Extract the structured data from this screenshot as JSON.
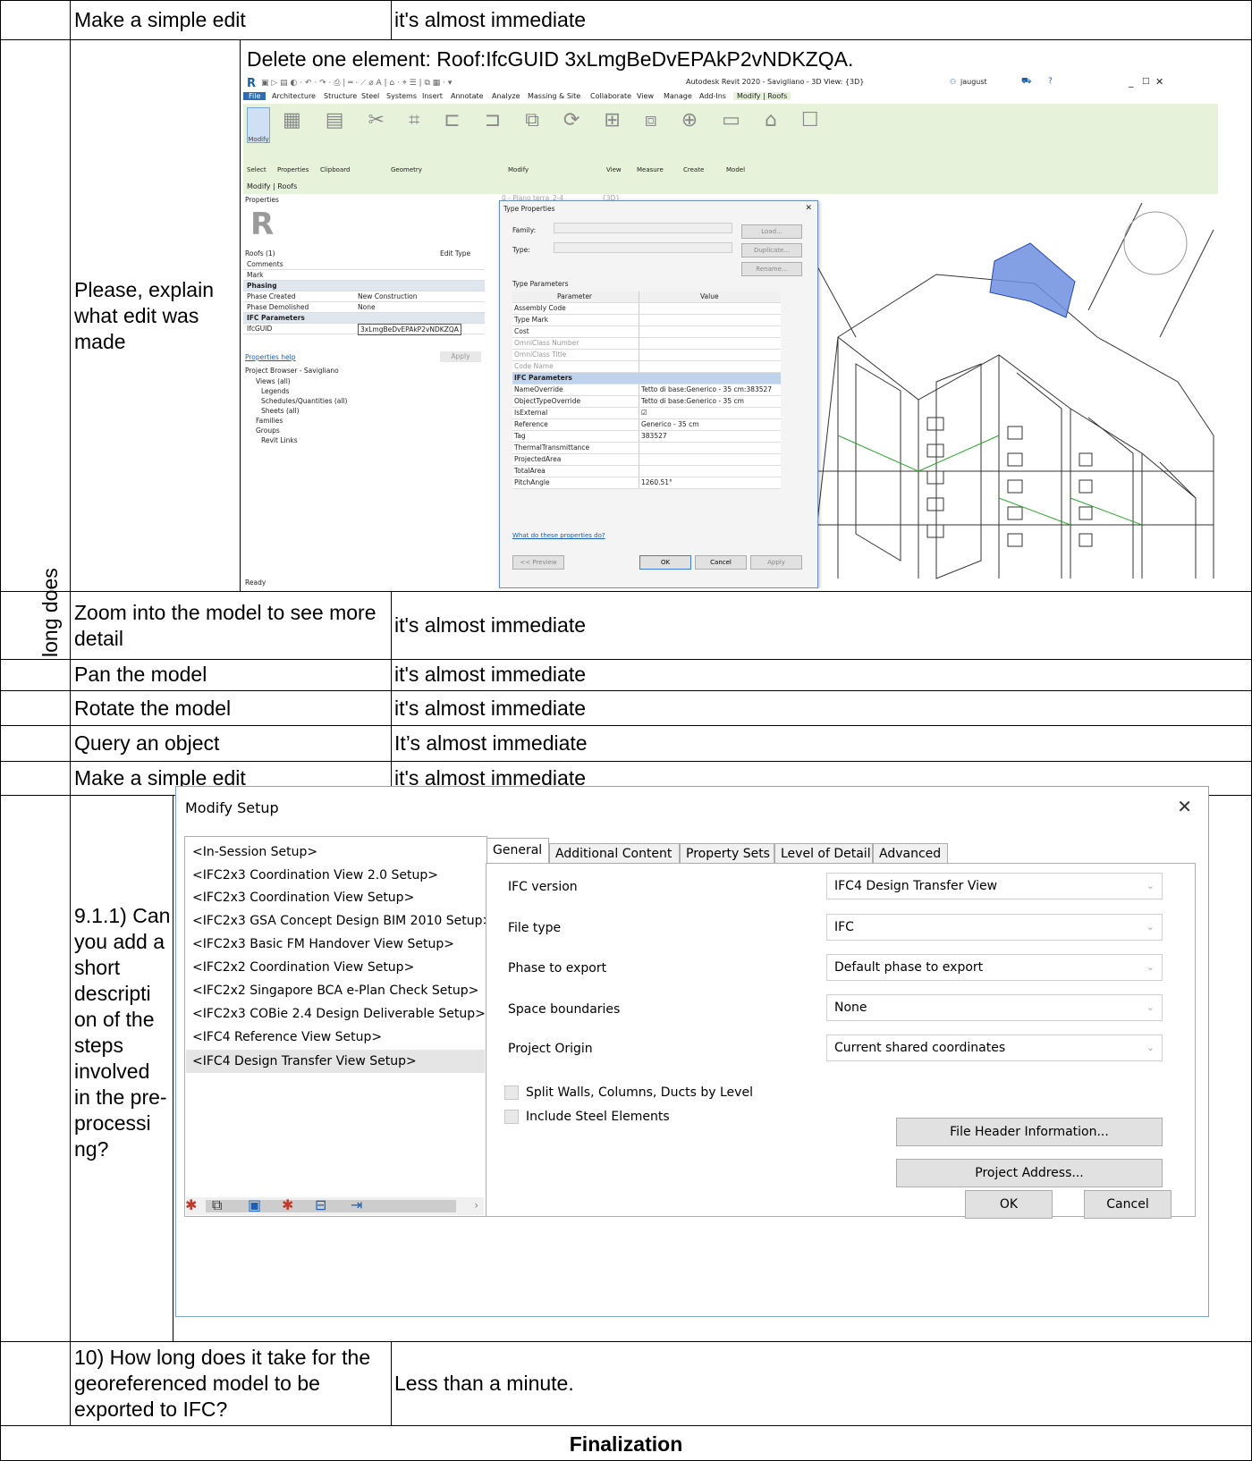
{
  "table": {
    "rows": [
      {
        "q": "Make a simple edit",
        "a": "it's almost immediate"
      },
      {
        "heading": "Delete one element: Roof:IfcGUID 3xLmgBeDvEPAkP2vNDKZQA.",
        "q": "Please, explain what edit was made"
      },
      {
        "side": "long does",
        "q": "Zoom into the model to see more detail",
        "a": "it's almost immediate"
      },
      {
        "q": "Pan the model",
        "a": "it's almost immediate"
      },
      {
        "q": "Rotate the model",
        "a": "it's almost immediate"
      },
      {
        "q": "Query an object",
        "a": "It’s almost immediate"
      },
      {
        "q": "Make a simple edit",
        "a": "it's almost immediate"
      },
      {
        "q": "9.1.1) Can you add a short descripti on of the steps involved in the pre- processi ng?"
      },
      {
        "q": "10) How long does it take for the georeferenced model to be exported to IFC?",
        "a": "Less than a minute."
      }
    ],
    "footer": "Finalization"
  },
  "revit": {
    "title": "Autodesk Revit 2020 - Savigliano - 3D View: {3D}",
    "user": "jaugust",
    "tabs": [
      "File",
      "Architecture",
      "Structure",
      "Steel",
      "Systems",
      "Insert",
      "Annotate",
      "Analyze",
      "Massing & Site",
      "Collaborate",
      "View",
      "Manage",
      "Add-Ins",
      "Modify | Roofs"
    ],
    "ribbon_groups": [
      "Select",
      "Properties",
      "Clipboard",
      "Geometry",
      "Modify",
      "View",
      "Measure",
      "Create",
      "Model"
    ],
    "context": "Modify | Roofs",
    "properties_header": "Properties",
    "type_selector": "Roofs (1)",
    "edit_type": "Edit Type",
    "props": [
      {
        "k": "Comments",
        "v": ""
      },
      {
        "k": "Mark",
        "v": ""
      },
      {
        "k": "Phasing",
        "v": "",
        "section": true
      },
      {
        "k": "Phase Created",
        "v": "New Construction"
      },
      {
        "k": "Phase Demolished",
        "v": "None"
      },
      {
        "k": "IFC Parameters",
        "v": "",
        "section": true
      },
      {
        "k": "IfcGUID",
        "v": "3xLmgBeDvEPAkP2vNDKZQA"
      }
    ],
    "properties_help": "Properties help",
    "apply": "Apply",
    "browser_title": "Project Browser - Savigliano",
    "browser_items": [
      "Views (all)",
      "Legends",
      "Schedules/Quantities (all)",
      "Sheets (all)",
      "Families",
      "Groups",
      "Revit Links"
    ],
    "status": "Ready",
    "view_tabs": [
      "0 - Piano terra_2-4",
      "{3D}"
    ],
    "type_properties": {
      "title": "Type Properties",
      "family_label": "Family:",
      "type_label": "Type:",
      "load": "Load...",
      "duplicate": "Duplicate...",
      "rename": "Rename...",
      "section": "Type Parameters",
      "col_param": "Parameter",
      "col_value": "Value",
      "rows": [
        {
          "k": "Assembly Code",
          "v": ""
        },
        {
          "k": "Type Mark",
          "v": ""
        },
        {
          "k": "Cost",
          "v": ""
        },
        {
          "k": "OmniClass Number",
          "v": ""
        },
        {
          "k": "OmniClass Title",
          "v": ""
        },
        {
          "k": "Code Name",
          "v": ""
        },
        {
          "k": "IFC Parameters",
          "v": "",
          "section": true
        },
        {
          "k": "NameOverride",
          "v": "Tetto di base:Generico - 35 cm:383527"
        },
        {
          "k": "ObjectTypeOverride",
          "v": "Tetto di base:Generico - 35 cm"
        },
        {
          "k": "IsExternal",
          "v": "☑"
        },
        {
          "k": "Reference",
          "v": "Generico - 35 cm"
        },
        {
          "k": "Tag",
          "v": "383527"
        },
        {
          "k": "ThermalTransmittance",
          "v": ""
        },
        {
          "k": "ProjectedArea",
          "v": ""
        },
        {
          "k": "TotalArea",
          "v": ""
        },
        {
          "k": "PitchAngle",
          "v": "1260.51°"
        }
      ],
      "help_link": "What do these properties do?",
      "preview": "<< Preview",
      "ok": "OK",
      "cancel": "Cancel",
      "apply": "Apply"
    }
  },
  "modify_setup": {
    "title": "Modify Setup",
    "setups": [
      "<In-Session Setup>",
      "<IFC2x3 Coordination View 2.0 Setup>",
      "<IFC2x3 Coordination View Setup>",
      "<IFC2x3 GSA Concept Design BIM 2010 Setup>",
      "<IFC2x3 Basic FM Handover View Setup>",
      "<IFC2x2 Coordination View Setup>",
      "<IFC2x2 Singapore BCA e-Plan Check Setup>",
      "<IFC2x3 COBie 2.4 Design Deliverable Setup>",
      "<IFC4 Reference View Setup>",
      "<IFC4 Design Transfer View Setup>"
    ],
    "tabs": [
      "General",
      "Additional Content",
      "Property Sets",
      "Level of Detail",
      "Advanced"
    ],
    "fields": [
      {
        "label": "IFC version",
        "value": "IFC4 Design Transfer View"
      },
      {
        "label": "File type",
        "value": "IFC"
      },
      {
        "label": "Phase to export",
        "value": "Default phase to export"
      },
      {
        "label": "Space boundaries",
        "value": "None"
      },
      {
        "label": "Project Origin",
        "value": "Current shared coordinates"
      }
    ],
    "checkboxes": [
      "Split Walls, Columns, Ducts by Level",
      "Include Steel Elements"
    ],
    "file_header": "File Header Information...",
    "project_address": "Project Address...",
    "ok": "OK",
    "cancel": "Cancel"
  }
}
